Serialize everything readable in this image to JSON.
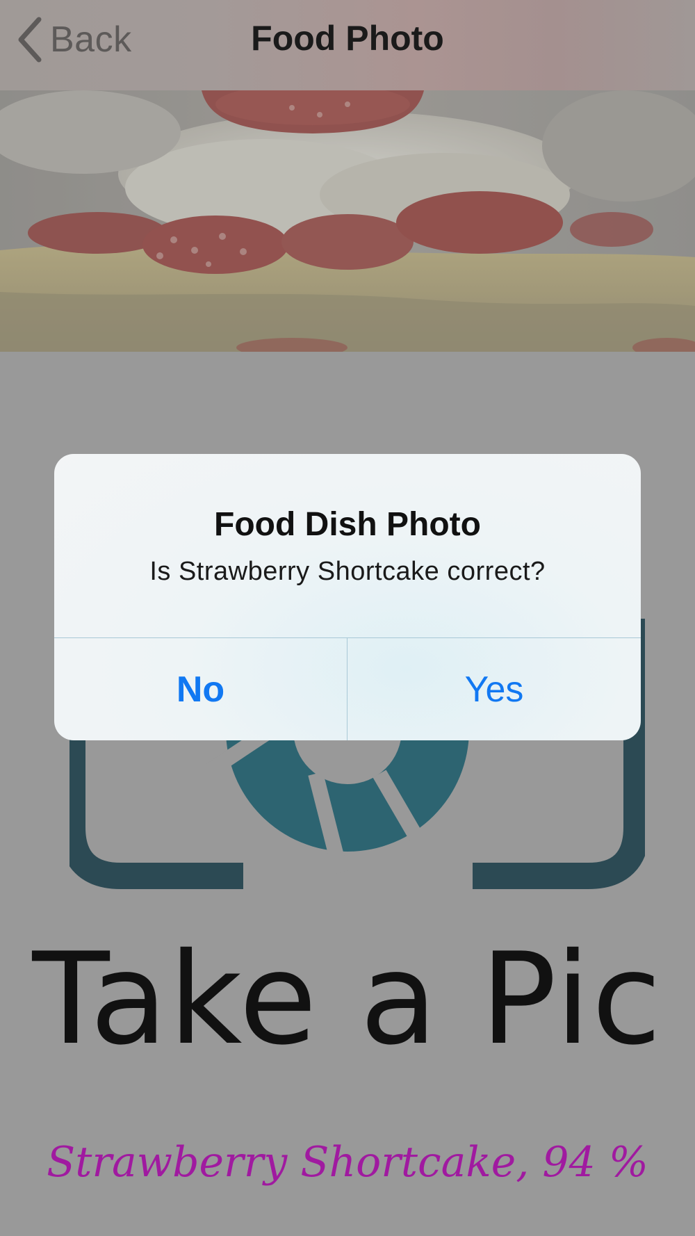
{
  "nav": {
    "back_label": "Back",
    "title": "Food Photo"
  },
  "logo": {
    "text": "Take a Pic",
    "color": "#2d6471"
  },
  "result": {
    "text": "Strawberry Shortcake, 94 %",
    "color": "#a01aa0"
  },
  "alert": {
    "title": "Food Dish Photo",
    "message": "Is Strawberry Shortcake correct?",
    "buttons": {
      "no": "No",
      "yes": "Yes"
    },
    "button_color": "#1178f2"
  },
  "icons": {
    "back": "chevron-left-icon",
    "logo": "camera-shutter-icon"
  }
}
